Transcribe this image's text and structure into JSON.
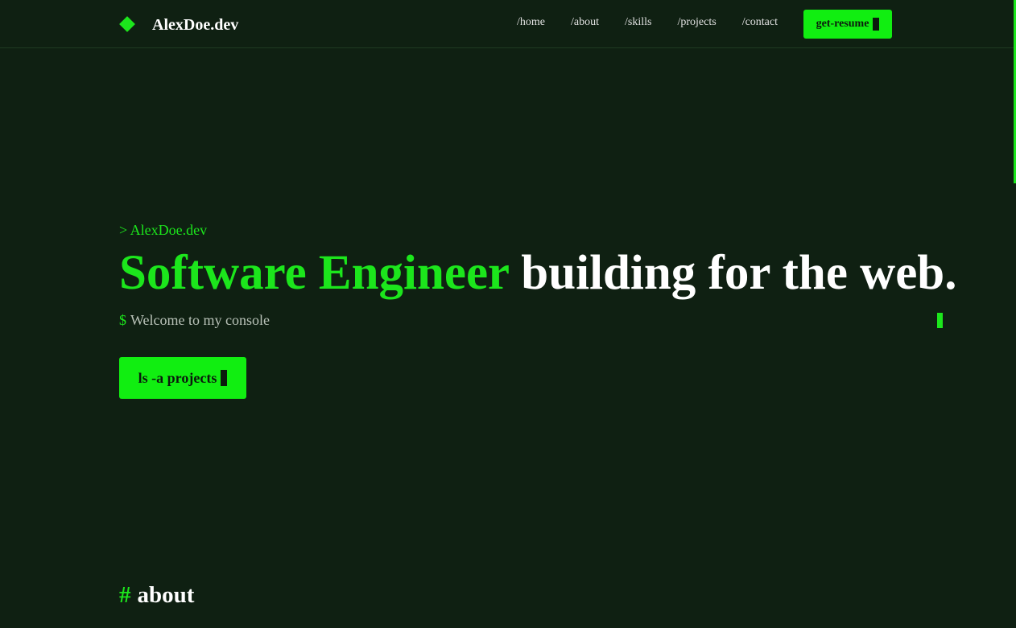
{
  "brand": {
    "icon": "diamond-icon",
    "name": "AlexDoe.dev"
  },
  "nav": {
    "links": [
      "/home",
      "/about",
      "/skills",
      "/projects",
      "/contact"
    ],
    "resume_button": "get-resume"
  },
  "hero": {
    "prompt": "> AlexDoe.dev",
    "headline_accent": "Software Engineer",
    "headline_rest": "building for the web.",
    "console_symbol": "$",
    "console_text": "Welcome to my console",
    "cta_label": "ls -a projects"
  },
  "about": {
    "hash": "#",
    "title": "about"
  },
  "colors": {
    "background": "#0f2012",
    "accent": "#1ce61c",
    "button": "#11ee11",
    "text": "#ffffff",
    "muted_text": "#b9c2b8"
  }
}
